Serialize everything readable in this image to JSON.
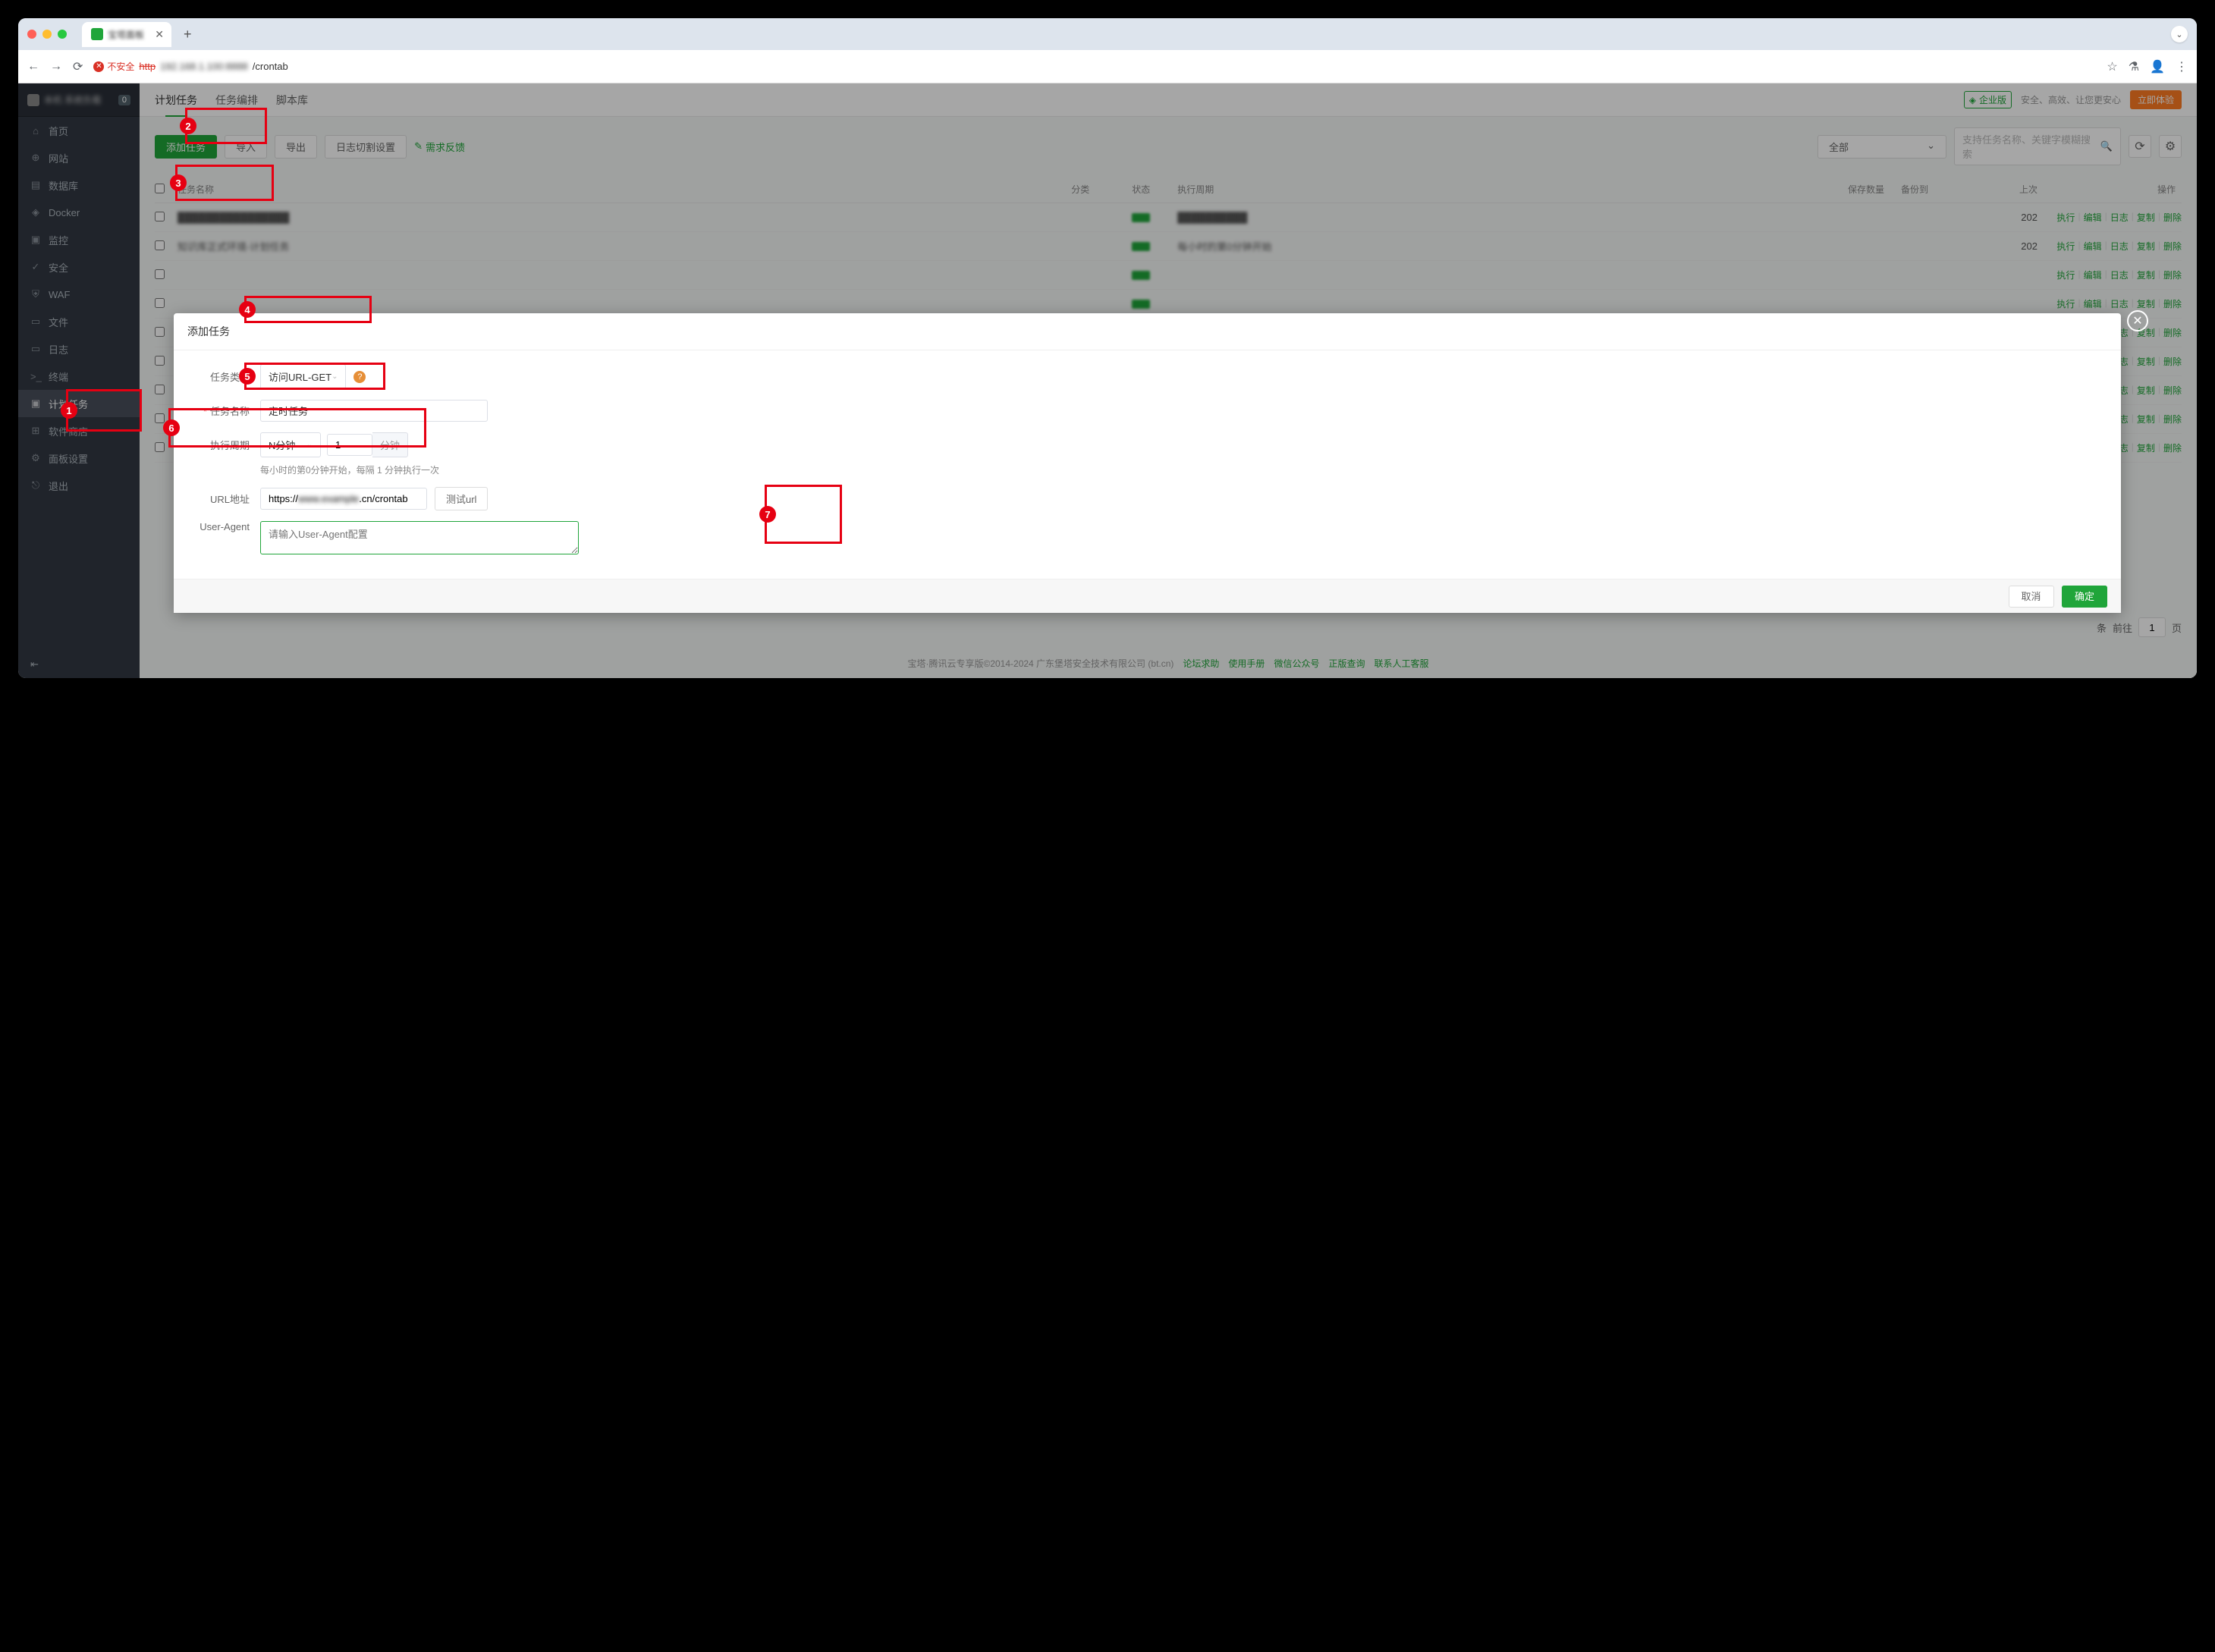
{
  "browser": {
    "tab_title": "宝塔面板",
    "security_label": "不安全",
    "url_protocol": "http",
    "url_blur": "192.168.1.100:8888",
    "url_path": "/crontab"
  },
  "sidebar": {
    "header_text": "本机 系统负载",
    "header_badge": "0",
    "items": [
      {
        "label": "首页",
        "icon": "⌂"
      },
      {
        "label": "网站",
        "icon": "⊕"
      },
      {
        "label": "数据库",
        "icon": "▤"
      },
      {
        "label": "Docker",
        "icon": "◈"
      },
      {
        "label": "监控",
        "icon": "▣"
      },
      {
        "label": "安全",
        "icon": "✓"
      },
      {
        "label": "WAF",
        "icon": "⛨"
      },
      {
        "label": "文件",
        "icon": "▭"
      },
      {
        "label": "日志",
        "icon": "▭"
      },
      {
        "label": "终端",
        "icon": ">_"
      },
      {
        "label": "计划任务",
        "icon": "▣"
      },
      {
        "label": "软件商店",
        "icon": "⊞"
      },
      {
        "label": "面板设置",
        "icon": "⚙"
      },
      {
        "label": "退出",
        "icon": "⎋"
      }
    ]
  },
  "topbar": {
    "tabs": [
      "计划任务",
      "任务编排",
      "脚本库"
    ],
    "enterprise": "企业版",
    "slogan": "安全、高效、让您更安心",
    "trial": "立即体验"
  },
  "toolbar": {
    "add": "添加任务",
    "import": "导入",
    "export": "导出",
    "logcut": "日志切割设置",
    "feedback": "需求反馈",
    "filter": "全部",
    "search_placeholder": "支持任务名称、关键字模糊搜索"
  },
  "table": {
    "headers": {
      "name": "任务名称",
      "category": "分类",
      "status": "状态",
      "period": "执行周期",
      "keep": "保存数量",
      "backup": "备份到",
      "last": "上次",
      "ops": "操作"
    },
    "ops": {
      "exec": "执行",
      "edit": "编辑",
      "log": "日志",
      "copy": "复制",
      "delete": "删除"
    },
    "rows": [
      {
        "name": "████████████████",
        "status": "正常",
        "period": "██████████",
        "last": "202"
      },
      {
        "name": "知识库正式环境-计划任务",
        "status": "正常",
        "period": "每小时的第0分钟开始",
        "last": "202"
      },
      {
        "name": "",
        "period": "",
        "last": ""
      },
      {
        "name": "",
        "period": "",
        "last": ""
      },
      {
        "name": "",
        "period": "",
        "last": ""
      },
      {
        "name": "",
        "period": "",
        "last": ""
      },
      {
        "name": "",
        "period": "",
        "last": ""
      },
      {
        "name": "",
        "period": "",
        "last": ""
      },
      {
        "name": "",
        "period": "",
        "last": ""
      }
    ]
  },
  "pagination": {
    "unit": "条",
    "goto": "前往",
    "page": "1",
    "suffix": "页"
  },
  "footer": {
    "copyright": "宝塔·腾讯云专享版©2014-2024 广东堡塔安全技术有限公司 (bt.cn)",
    "links": [
      "论坛求助",
      "使用手册",
      "微信公众号",
      "正版查询",
      "联系人工客服"
    ]
  },
  "modal": {
    "title": "添加任务",
    "fields": {
      "type_label": "任务类型",
      "type_value": "访问URL-GET",
      "name_label": "任务名称",
      "name_value": "定时任务",
      "period_label": "执行周期",
      "period_type": "N分钟",
      "period_num": "1",
      "period_unit": "分钟",
      "period_hint": "每小时的第0分钟开始，每隔 1 分钟执行一次",
      "url_label": "URL地址",
      "url_value_pre": "https://",
      "url_value_blur": "www.example",
      "url_value_post": ".cn/crontab",
      "url_test": "测试url",
      "ua_label": "User-Agent",
      "ua_placeholder": "请输入User-Agent配置"
    },
    "buttons": {
      "cancel": "取消",
      "confirm": "确定"
    }
  },
  "annotations": [
    "1",
    "2",
    "3",
    "4",
    "5",
    "6",
    "7"
  ]
}
